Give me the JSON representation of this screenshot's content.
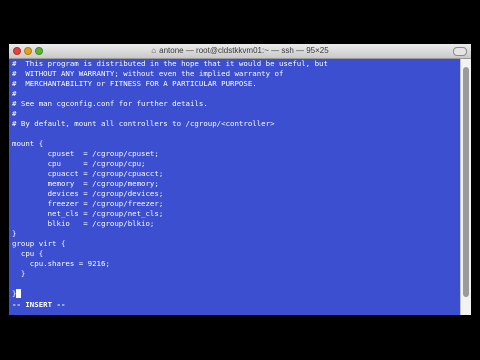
{
  "window": {
    "title": "antone — root@cldstkkvm01:~ — ssh — 95×25",
    "title_icon": "home-icon"
  },
  "terminal": {
    "lines": [
      "#  This program is distributed in the hope that it would be useful, but",
      "#  WITHOUT ANY WARRANTY; without even the implied warranty of",
      "#  MERCHANTABILITY or FITNESS FOR A PARTICULAR PURPOSE.",
      "#",
      "# See man cgconfig.conf for further details.",
      "#",
      "# By default, mount all controllers to /cgroup/<controller>",
      "",
      "mount {",
      "        cpuset  = /cgroup/cpuset;",
      "        cpu     = /cgroup/cpu;",
      "        cpuacct = /cgroup/cpuacct;",
      "        memory  = /cgroup/memory;",
      "        devices = /cgroup/devices;",
      "        freezer = /cgroup/freezer;",
      "        net_cls = /cgroup/net_cls;",
      "        blkio   = /cgroup/blkio;",
      "}",
      "group virt {",
      "  cpu {",
      "    cpu.shares = 9216;",
      "  }",
      "",
      "}"
    ],
    "mode_line": "-- INSERT --",
    "background_color": "#3b4fd0",
    "text_color": "#ffffff"
  },
  "scrollbar": {
    "thumb_start_fraction": 0.03,
    "thumb_length_fraction": 0.9
  }
}
